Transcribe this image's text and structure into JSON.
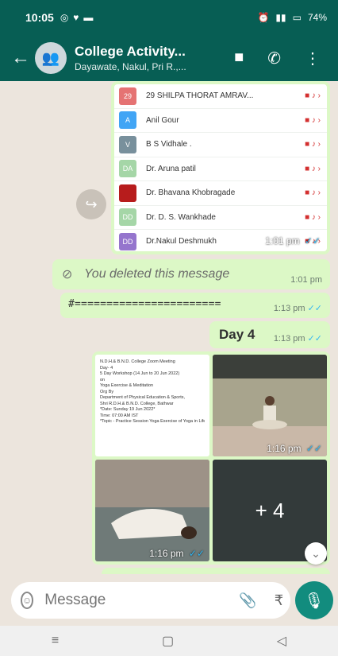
{
  "status": {
    "time": "10:05",
    "battery": "74%"
  },
  "header": {
    "title": "College Activity...",
    "subtitle": "Dayawate, Nakul, Pri R.,..."
  },
  "contacts_image": {
    "rows": [
      {
        "avatar": "29",
        "name": "29 SHILPA THORAT AMRAV...",
        "color": "#e57373"
      },
      {
        "avatar": "A",
        "name": "Anil Gour",
        "color": "#42a5f5"
      },
      {
        "avatar": "V",
        "name": "B S Vidhale .",
        "color": "#78909c"
      },
      {
        "avatar": "DA",
        "name": "Dr. Aruna patil",
        "color": "#a5d6a7"
      },
      {
        "avatar": "",
        "name": "Dr. Bhavana Khobragade",
        "color": "#b71c1c"
      },
      {
        "avatar": "DD",
        "name": "Dr. D. S. Wankhade",
        "color": "#a5d6a7"
      },
      {
        "avatar": "DD",
        "name": "Dr.Nakul Deshmukh",
        "color": "#9575cd"
      }
    ],
    "time": "1:01 pm"
  },
  "messages": {
    "deleted": {
      "text": "You deleted this message",
      "time": "1:01 pm"
    },
    "hash": {
      "text": "#=======================",
      "time": "1:13 pm"
    },
    "day": {
      "text": "Day 4",
      "time": "1:13 pm"
    }
  },
  "media": {
    "doc_lines": [
      "N.D.H.& B.N.D. College Zoom Meeting",
      "Day- 4",
      "5 Day Workshop (14 Jun to 20 Jun 2022)",
      "on",
      "Yoga Exercise & Meditation",
      "Org By",
      "Department of Physical Education & Sports,",
      "Shri R.D.H.& B.N.D. College, Bathwar",
      "*Date: Sunday 19 Jun 2022*",
      "Time: 07:00 AM IST",
      "*Topic - Practice Session Yoga Exercise of Yoga in Life*"
    ],
    "time2": "1:16 pm",
    "time3": "1:16 pm",
    "more": "+ 4"
  },
  "composer": {
    "placeholder": "Message"
  }
}
